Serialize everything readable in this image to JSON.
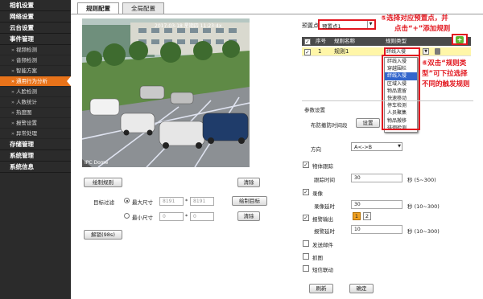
{
  "sidebar": {
    "groups": [
      {
        "label": "相机设置"
      },
      {
        "label": "网络设置"
      },
      {
        "label": "云台设置"
      },
      {
        "label": "事件管理"
      }
    ],
    "event_items": [
      {
        "label": "视频检测"
      },
      {
        "label": "音频检测"
      },
      {
        "label": "智能方案"
      },
      {
        "label": "通用行为分析"
      },
      {
        "label": "人脸检测"
      },
      {
        "label": "人数统计"
      },
      {
        "label": "热度图"
      },
      {
        "label": "报警设置"
      },
      {
        "label": "异常处理"
      }
    ],
    "bottom_groups": [
      {
        "label": "存储管理"
      },
      {
        "label": "系统管理"
      },
      {
        "label": "系统信息"
      }
    ],
    "bullet": "»"
  },
  "tabs": [
    {
      "label": "规则配置"
    },
    {
      "label": "全局配置"
    }
  ],
  "video": {
    "timestamp": "2017-03-18 星期四 11:23:4x",
    "osd_name": "IPC Dome"
  },
  "left_buttons": {
    "draw_rule": "绘制规则",
    "clear1": "清除",
    "draw_target": "绘制目标",
    "clear2": "清除",
    "unlock": "解锁(98s)"
  },
  "target_filter": {
    "label": "目标过滤",
    "max": {
      "label": "最大尺寸",
      "w": "8191",
      "h": "8191"
    },
    "min": {
      "label": "最小尺寸",
      "w": "0",
      "h": "0"
    },
    "sep": "*"
  },
  "preset": {
    "label": "预置点",
    "value": "预置点1"
  },
  "annotations": {
    "a5_line1": "⑤选择对应预置点，并",
    "a5_line2": "点击“+”添加规则",
    "a6_line1": "⑥双击“规则类",
    "a6_line2": "型”可下拉选择",
    "a6_line3": "不同的触发规则"
  },
  "rules_table": {
    "headers": {
      "no": "序号",
      "name": "规则名称",
      "type": "规则类型"
    },
    "rows": [
      {
        "no": "1",
        "name": "规则1",
        "type": "绊线入侵"
      }
    ]
  },
  "rule_type_options": [
    "绊线入侵",
    "穿越围栏",
    "绊线入侵",
    "区域入侵",
    "物品遗留",
    "快速移动",
    "停车检测",
    "人员聚集",
    "物品搬移",
    "徘徊检测"
  ],
  "params": {
    "section_title": "参数设置",
    "schedule_label": "布防撤防时间段",
    "schedule_btn": "设置",
    "direction_label": "方向",
    "direction_value": "A<->B",
    "track_label": "物体跟踪",
    "track_time_label": "跟踪时间",
    "track_time_value": "30",
    "track_time_unit": "秒 (5~300)",
    "record_label": "录像",
    "record_delay_label": "录像延时",
    "record_delay_value": "30",
    "record_delay_unit": "秒 (10~300)",
    "alarm_out_label": "报警输出",
    "alarm_out_1": "1",
    "alarm_out_2": "2",
    "alarm_delay_label": "报警延时",
    "alarm_delay_value": "10",
    "alarm_delay_unit": "秒 (10~300)",
    "email_label": "发送邮件",
    "snapshot_label": "抓图",
    "sms_label": "短信联动"
  },
  "footer": {
    "refresh": "刷新",
    "confirm": "确定"
  },
  "colors": {
    "accent": "#e8731a",
    "annotation": "#e2171f",
    "selected_row": "#fff6a8",
    "add_button": "#5cb531"
  }
}
